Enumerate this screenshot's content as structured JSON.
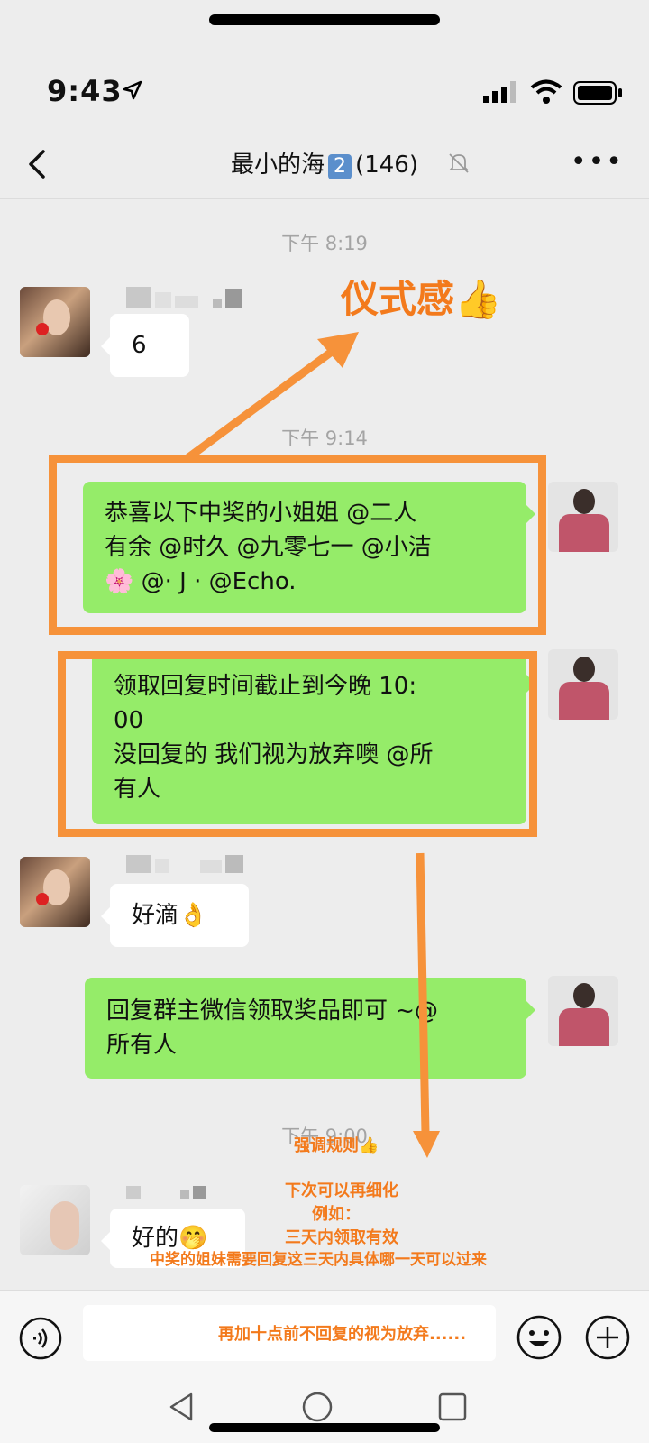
{
  "status_bar": {
    "time": "9:43"
  },
  "header": {
    "title": "最小的海",
    "badge": "2",
    "count": "(146)"
  },
  "timestamps": [
    "下午 8:19",
    "下午 9:14",
    "下午 9:00"
  ],
  "messages": [
    {
      "text": "6"
    },
    {
      "lines": [
        "恭喜以下中奖的小姐姐 @二人",
        "有余 @时久 @九零七一 @小洁",
        "🌸 @· J · @Echo."
      ]
    },
    {
      "lines": [
        "领取回复时间截止到今晚 10:",
        "00",
        "没回复的 我们视为放弃噢 @所",
        "有人"
      ]
    },
    {
      "text": "好滴👌"
    },
    {
      "lines": [
        "回复群主微信领取奖品即可 ~@",
        "所有人"
      ]
    },
    {
      "text": "好的🤭"
    }
  ],
  "annotations": {
    "ritual": "仪式感👍",
    "emphasize": "强调规则👍",
    "notes": [
      "下次可以再细化",
      "例如：",
      "三天内领取有效",
      "中奖的姐妹需要回复这三天内具体哪一天可以过来",
      "再加十点前不回复的视为放弃......"
    ]
  },
  "colors": {
    "accent": "#f6923a",
    "green_bubble": "#95ec69",
    "badge_blue": "#5b8fcc"
  },
  "icons": [
    "location-arrow-icon",
    "signal-icon",
    "wifi-icon",
    "battery-icon",
    "back-chevron-icon",
    "mute-bell-icon",
    "more-dots-icon",
    "voice-icon",
    "emoji-icon",
    "plus-icon",
    "nav-back-icon",
    "nav-home-icon",
    "nav-recents-icon"
  ]
}
